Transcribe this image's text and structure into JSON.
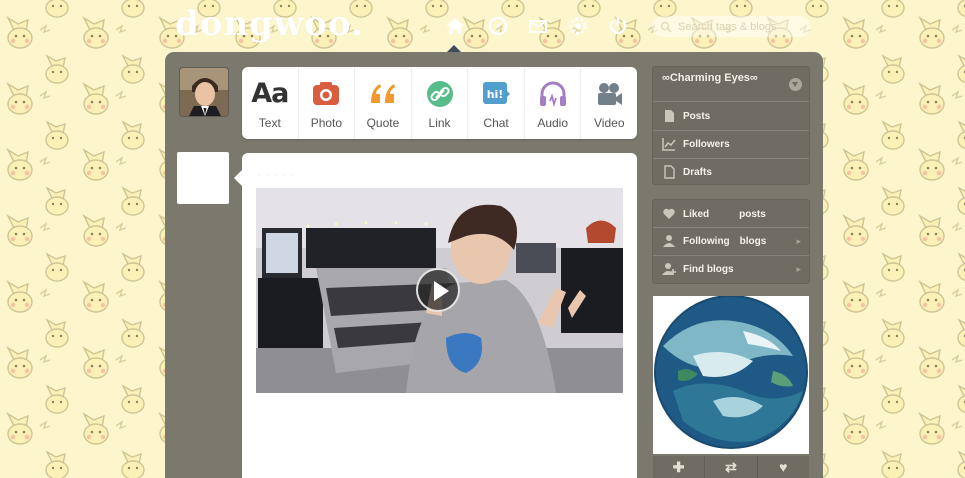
{
  "header": {
    "logo_text": "dongwoo.",
    "nav_icons": [
      "home-icon",
      "explore-icon",
      "inbox-icon",
      "settings-icon",
      "power-icon"
    ],
    "search": {
      "placeholder": "Search tags & blogs"
    }
  },
  "post_types": [
    {
      "label": "Text",
      "icon": "text-icon",
      "glyph": "Aa",
      "color": "#333333"
    },
    {
      "label": "Photo",
      "icon": "camera-icon",
      "color": "#d95e40"
    },
    {
      "label": "Quote",
      "icon": "quote-icon",
      "color": "#f2992e"
    },
    {
      "label": "Link",
      "icon": "link-icon",
      "color": "#56bc8a"
    },
    {
      "label": "Chat",
      "icon": "chat-icon",
      "glyph": "hi!",
      "color": "#529ecc"
    },
    {
      "label": "Audio",
      "icon": "headphones-icon",
      "color": "#a77dc2"
    },
    {
      "label": "Video",
      "icon": "video-camera-icon",
      "color": "#748089"
    }
  ],
  "post": {
    "username": "· · · · ·",
    "media": "video"
  },
  "sidebar": {
    "blog_title": "∞Charming Eyes∞",
    "blog_items": [
      {
        "label": "Posts",
        "icon": "document-icon"
      },
      {
        "label": "Followers",
        "icon": "chart-icon"
      },
      {
        "label": "Drafts",
        "icon": "draft-icon"
      }
    ],
    "account_items": [
      {
        "label": "Liked",
        "extra": "posts",
        "icon": "heart-icon"
      },
      {
        "label": "Following",
        "extra": "blogs",
        "icon": "person-icon"
      },
      {
        "label": "Find blogs",
        "extra": "",
        "icon": "add-person-icon"
      }
    ],
    "radar_actions": [
      {
        "glyph": "✚",
        "icon": "plus-icon"
      },
      {
        "glyph": "⇄",
        "icon": "reblog-icon"
      },
      {
        "glyph": "♥",
        "icon": "heart-icon"
      }
    ]
  },
  "colors": {
    "background": "#fdf6cc",
    "dashboard": "#7b796e",
    "sidebar_box": "#6f6d63"
  }
}
